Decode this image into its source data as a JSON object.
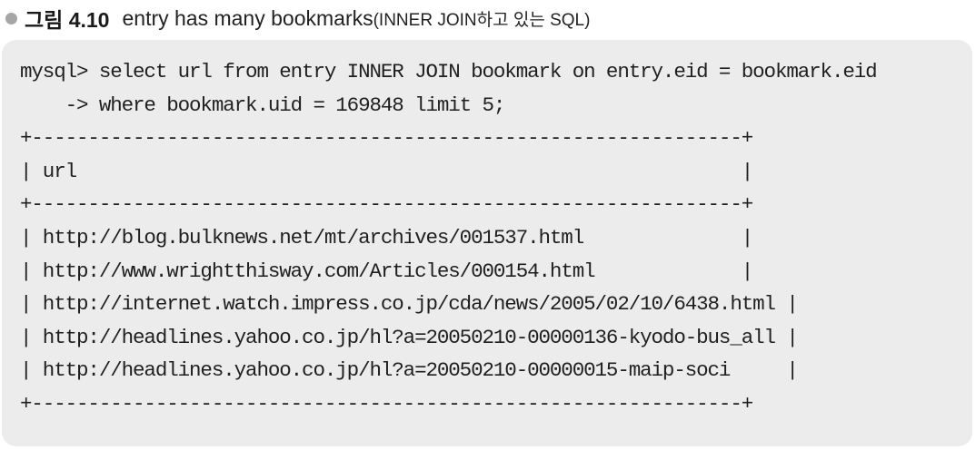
{
  "caption": {
    "label": "그림 4.10",
    "title": "entry has many bookmarks",
    "subtitle": "(INNER JOIN하고 있는 SQL)"
  },
  "code": {
    "lines": [
      "mysql> select url from entry INNER JOIN bookmark on entry.eid = bookmark.eid",
      "    -> where bookmark.uid = 169848 limit 5;",
      "+---------------------------------------------------------------+",
      "| url                                                           |",
      "+---------------------------------------------------------------+",
      "| http://blog.bulknews.net/mt/archives/001537.html              |",
      "| http://www.wrightthisway.com/Articles/000154.html             |",
      "| http://internet.watch.impress.co.jp/cda/news/2005/02/10/6438.html |",
      "| http://headlines.yahoo.co.jp/hl?a=20050210-00000136-kyodo-bus_all |",
      "| http://headlines.yahoo.co.jp/hl?a=20050210-00000015-maip-soci     |",
      "+---------------------------------------------------------------+"
    ]
  }
}
